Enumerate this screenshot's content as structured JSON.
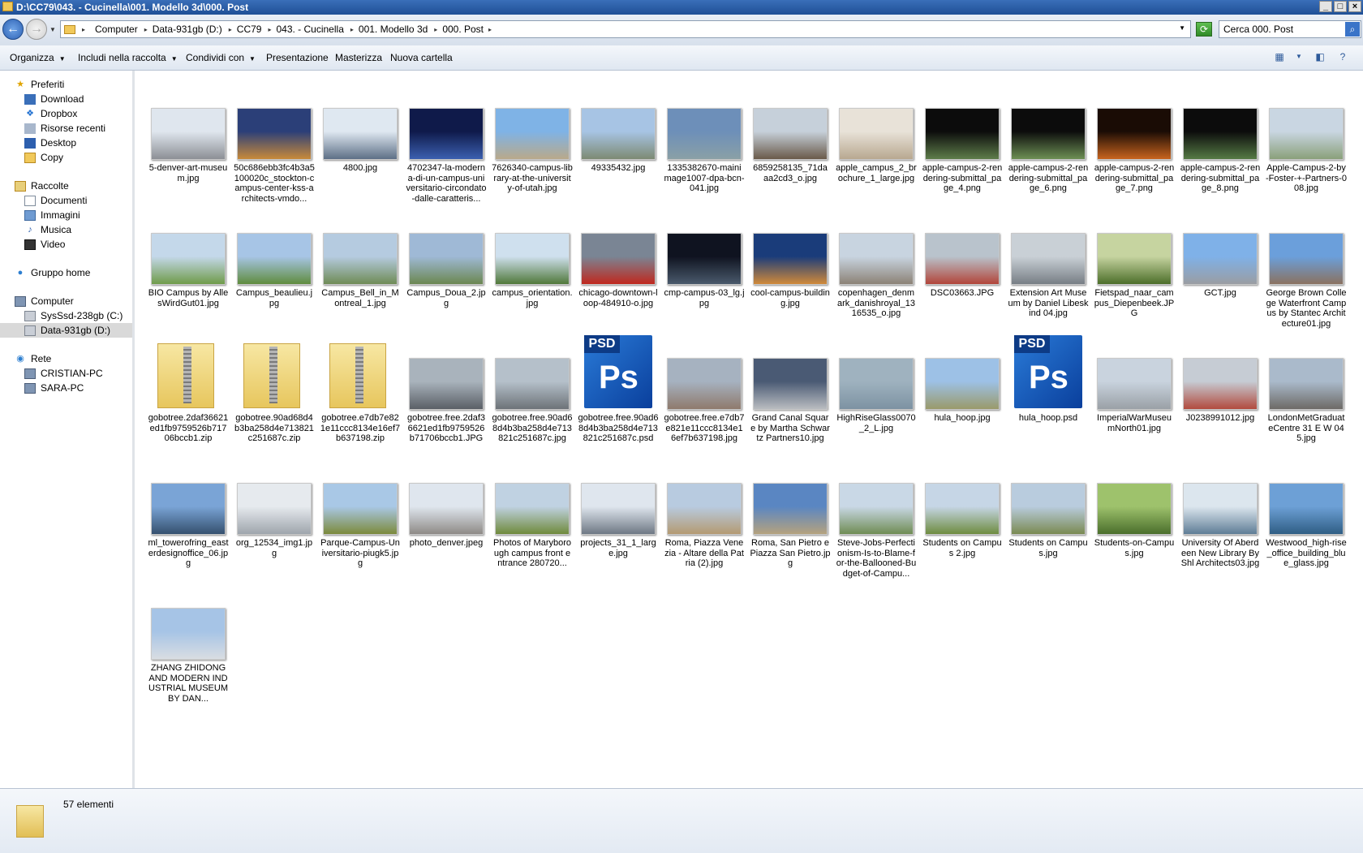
{
  "window": {
    "title": "D:\\CC79\\043. - Cucinella\\001. Modello 3d\\000. Post"
  },
  "address": {
    "crumbs": [
      "Computer",
      "Data-931gb (D:)",
      "CC79",
      "043. - Cucinella",
      "001. Modello 3d",
      "000. Post"
    ],
    "search_placeholder": "Cerca 000. Post"
  },
  "toolbar": {
    "organizza": "Organizza",
    "includi": "Includi nella raccolta",
    "condividi": "Condividi con",
    "presentazione": "Presentazione",
    "masterizza": "Masterizza",
    "nuova_cartella": "Nuova cartella"
  },
  "nav": {
    "preferiti": "Preferiti",
    "download": "Download",
    "dropbox": "Dropbox",
    "recenti": "Risorse recenti",
    "desktop": "Desktop",
    "copy": "Copy",
    "raccolte": "Raccolte",
    "documenti": "Documenti",
    "immagini": "Immagini",
    "musica": "Musica",
    "video": "Video",
    "gruppo": "Gruppo home",
    "computer": "Computer",
    "drive_c": "SysSsd-238gb (C:)",
    "drive_d": "Data-931gb (D:)",
    "rete": "Rete",
    "pc1": "CRISTIAN-PC",
    "pc2": "SARA-PC"
  },
  "files": [
    {
      "name": "5-denver-art-museum.jpg",
      "type": "img",
      "c1": "#dfe6ee",
      "c2": "#8c8f95"
    },
    {
      "name": "50c686ebb3fc4b3a5100020c_stockton-campus-center-kss-architects-vmdo...",
      "type": "img",
      "c1": "#2b3f78",
      "c2": "#c88a3a"
    },
    {
      "name": "4800.jpg",
      "type": "img",
      "c1": "#dfe8f1",
      "c2": "#5d6f86"
    },
    {
      "name": "4702347-la-modern a-di-un-campus-universitario-circondato-dalle-caratteris...",
      "type": "img",
      "c1": "#0f1a4a",
      "c2": "#3b5fb0"
    },
    {
      "name": "7626340-campus-library-at-the-university-of-utah.jpg",
      "type": "img",
      "c1": "#7fb3e6",
      "c2": "#b9a98a"
    },
    {
      "name": "49335432.jpg",
      "type": "img",
      "c1": "#a7c4e4",
      "c2": "#7d8a73"
    },
    {
      "name": "1335382670-mainimage1007-dpa-bcn-041.jpg",
      "type": "img",
      "c1": "#6d8fb9",
      "c2": "#8aa0a6"
    },
    {
      "name": "6859258135_71da aa2cd3_o.jpg",
      "type": "img",
      "c1": "#c6d0da",
      "c2": "#6a5a4a"
    },
    {
      "name": "apple_campus_2_brochure_1_large.jpg",
      "type": "img",
      "c1": "#e8e2d8",
      "c2": "#b8a890"
    },
    {
      "name": "apple-campus-2-rendering-submittal_page_4.png",
      "type": "img",
      "c1": "#0c0c0c",
      "c2": "#5e7d4a"
    },
    {
      "name": "apple-campus-2-rendering-submittal_page_6.png",
      "type": "img",
      "c1": "#0c0c0c",
      "c2": "#6d8f54"
    },
    {
      "name": "apple-campus-2-rendering-submittal_page_7.png",
      "type": "img",
      "c1": "#1a0c05",
      "c2": "#c8641e"
    },
    {
      "name": "apple-campus-2-rendering-submittal_page_8.png",
      "type": "img",
      "c1": "#0c0c0c",
      "c2": "#557a44"
    },
    {
      "name": "Apple-Campus-2-by-Foster-+-Partners-008.jpg",
      "type": "img",
      "c1": "#c9d6e2",
      "c2": "#8aa07a"
    },
    {
      "name": "BIO Campus by AllesWirdGut01.jpg",
      "type": "img",
      "c1": "#c4d8ea",
      "c2": "#6f9b4a"
    },
    {
      "name": "Campus_beaulieu.jpg",
      "type": "img",
      "c1": "#a7c5e6",
      "c2": "#5f8c3e"
    },
    {
      "name": "Campus_Bell_in_Montreal_1.jpg",
      "type": "img",
      "c1": "#b5cbe0",
      "c2": "#6f8b56"
    },
    {
      "name": "Campus_Doua_2.jpg",
      "type": "img",
      "c1": "#9fb9d6",
      "c2": "#6b8751"
    },
    {
      "name": "campus_orientation.jpg",
      "type": "img",
      "c1": "#cfe0ee",
      "c2": "#50783a"
    },
    {
      "name": "chicago-downtown-loop-484910-o.jpg",
      "type": "img",
      "c1": "#7a8594",
      "c2": "#c0281e"
    },
    {
      "name": "cmp-campus-03_lg.jpg",
      "type": "img",
      "c1": "#0f1320",
      "c2": "#4a5a6c"
    },
    {
      "name": "cool-campus-building.jpg",
      "type": "img",
      "c1": "#1a3c7a",
      "c2": "#d08a3a"
    },
    {
      "name": "copenhagen_denmark_danishroyal_1316535_o.jpg",
      "type": "img",
      "c1": "#c8d4e0",
      "c2": "#8c8276"
    },
    {
      "name": "DSC03663.JPG",
      "type": "img",
      "c1": "#b9c3cc",
      "c2": "#b2453a"
    },
    {
      "name": "Extension Art Museum by Daniel Libeskind 04.jpg",
      "type": "img",
      "c1": "#c9d0d6",
      "c2": "#777e85"
    },
    {
      "name": "Fietspad_naar_campus_Diepenbeek.JPG",
      "type": "img",
      "c1": "#c6d4a0",
      "c2": "#4c6e2a"
    },
    {
      "name": "GCT.jpg",
      "type": "img",
      "c1": "#7fb1e8",
      "c2": "#9a9da2"
    },
    {
      "name": "George Brown College Waterfront Campus by Stantec Architecture01.jpg",
      "type": "img",
      "c1": "#6b9fdb",
      "c2": "#8a7260"
    },
    {
      "name": "gobotree.2daf36621ed1fb9759526b71706bccb1.zip",
      "type": "zip"
    },
    {
      "name": "gobotree.90ad68d4b3ba258d4e713821c251687c.zip",
      "type": "zip"
    },
    {
      "name": "gobotree.e7db7e821e11ccc8134e16ef7b637198.zip",
      "type": "zip"
    },
    {
      "name": "gobotree.free.2daf36621ed1fb9759526b71706bccb1.JPG",
      "type": "img",
      "c1": "#a9b3bc",
      "c2": "#5a5f66"
    },
    {
      "name": "gobotree.free.90ad68d4b3ba258d4e713821c251687c.jpg",
      "type": "img",
      "c1": "#b5c0ca",
      "c2": "#6d7378"
    },
    {
      "name": "gobotree.free.90ad68d4b3ba258d4e713821c251687c.psd",
      "type": "psd"
    },
    {
      "name": "gobotree.free.e7db7e821e11ccc8134e16ef7b637198.jpg",
      "type": "img",
      "c1": "#a6b2c0",
      "c2": "#8f7a6c"
    },
    {
      "name": "Grand Canal Square by Martha Schwartz Partners10.jpg",
      "type": "img",
      "c1": "#4a5a74",
      "c2": "#b9bcc0"
    },
    {
      "name": "HighRiseGlass0070_2_L.jpg",
      "type": "img",
      "c1": "#9fb2bf",
      "c2": "#7d92a2"
    },
    {
      "name": "hula_hoop.jpg",
      "type": "img",
      "c1": "#9dc1e6",
      "c2": "#9a9a6a"
    },
    {
      "name": "hula_hoop.psd",
      "type": "psd"
    },
    {
      "name": "ImperialWarMuseumNorth01.jpg",
      "type": "img",
      "c1": "#c9d3de",
      "c2": "#9aa0a6"
    },
    {
      "name": "J0238991012.jpg",
      "type": "img",
      "c1": "#c6ccd4",
      "c2": "#b24a3e"
    },
    {
      "name": "LondonMetGraduateCentre 31 E W 045.jpg",
      "type": "img",
      "c1": "#aabacb",
      "c2": "#6d6a66"
    },
    {
      "name": "ml_towerofring_easterdesignoffice_06.jpg",
      "type": "img",
      "c1": "#7aa4d6",
      "c2": "#35506e"
    },
    {
      "name": "org_12534_img1.jpg",
      "type": "img",
      "c1": "#e6eaee",
      "c2": "#9ea5ac"
    },
    {
      "name": "Parque-Campus-Universitario-piugk5.jpg",
      "type": "img",
      "c1": "#a9c8e6",
      "c2": "#7c8a3c"
    },
    {
      "name": "photo_denver.jpeg",
      "type": "img",
      "c1": "#dfe6ee",
      "c2": "#8e8a86"
    },
    {
      "name": "Photos of Maryborough campus front entrance 280720...",
      "type": "img",
      "c1": "#c0d2e2",
      "c2": "#6f8a3c"
    },
    {
      "name": "projects_31_1_large.jpg",
      "type": "img",
      "c1": "#dfe6ee",
      "c2": "#6e7884"
    },
    {
      "name": "Roma, Piazza Venezia - Altare della Patria (2).jpg",
      "type": "img",
      "c1": "#b8cbe0",
      "c2": "#b49a72"
    },
    {
      "name": "Roma, San Pietro e Piazza San Pietro.jpg",
      "type": "img",
      "c1": "#5a86c2",
      "c2": "#b5a27e"
    },
    {
      "name": "Steve-Jobs-Perfectionism-Is-to-Blame-for-the-Ballooned-Budget-of-Campu...",
      "type": "img",
      "c1": "#c9d8e6",
      "c2": "#6f8c54"
    },
    {
      "name": "Students on Campus 2.jpg",
      "type": "img",
      "c1": "#c6d6e6",
      "c2": "#6e8c40"
    },
    {
      "name": "Students on Campus.jpg",
      "type": "img",
      "c1": "#b9ccde",
      "c2": "#7a8a52"
    },
    {
      "name": "Students-on-Campus.jpg",
      "type": "img",
      "c1": "#9ec26c",
      "c2": "#4a6e2c"
    },
    {
      "name": "University Of Aberdeen New Library By Shl Architects03.jpg",
      "type": "img",
      "c1": "#dce6ee",
      "c2": "#5f7d96"
    },
    {
      "name": "Westwood_high-rise_office_building_blue_glass.jpg",
      "type": "img",
      "c1": "#6da0d6",
      "c2": "#2f5e84"
    },
    {
      "name": "ZHANG ZHIDONG AND MODERN INDUSTRIAL MUSEUM BY DAN...",
      "type": "img",
      "c1": "#a6c4e6",
      "c2": "#d9dde2"
    }
  ],
  "status": {
    "count": "57 elementi"
  }
}
